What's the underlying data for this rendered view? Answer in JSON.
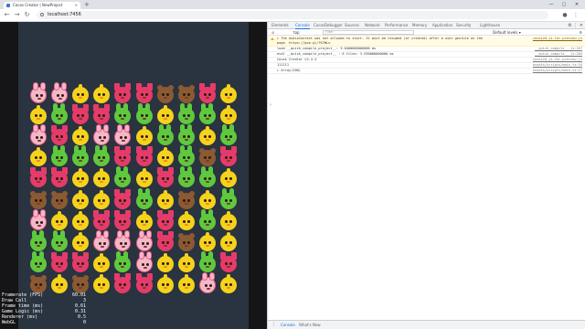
{
  "browser": {
    "tab_title": "Cocos Creator | NewProject",
    "tab_close": "×",
    "new_tab": "+",
    "address": "localhost:7456",
    "minimize": "—",
    "maximize": "▢",
    "close": "✕",
    "back": "←",
    "forward": "→",
    "reload": "↻",
    "profile": "●",
    "menu": "⋮"
  },
  "game": {
    "stats": [
      {
        "label": "Framerate (FPS)",
        "value": "60.01"
      },
      {
        "label": "Draw Call",
        "value": "3"
      },
      {
        "label": "Frame time (ms)",
        "value": "0.61"
      },
      {
        "label": "Game Logic (ms)",
        "value": "0.31"
      },
      {
        "label": "Renderer (ms)",
        "value": "0.5"
      },
      {
        "label": "WebGL",
        "value": "0"
      }
    ],
    "animal_colors": {
      "bunny": "#f5b7c8",
      "fox": "#e63b6a",
      "chick": "#f5d21c",
      "frog": "#5fc93e",
      "bear": "#8c5a32"
    },
    "grid": [
      [
        "bunny",
        "bunny",
        "chick",
        "chick",
        "fox",
        "fox",
        "bear",
        "bear",
        "fox",
        "chick"
      ],
      [
        "chick",
        "frog",
        "fox",
        "fox",
        "frog",
        "frog",
        "chick",
        "frog",
        "frog",
        "chick"
      ],
      [
        "bunny",
        "fox",
        "chick",
        "bunny",
        "bunny",
        "chick",
        "frog",
        "frog",
        "chick",
        "frog"
      ],
      [
        "chick",
        "frog",
        "frog",
        "frog",
        "fox",
        "fox",
        "chick",
        "frog",
        "bear",
        "fox"
      ],
      [
        "fox",
        "fox",
        "chick",
        "chick",
        "frog",
        "chick",
        "fox",
        "frog",
        "frog",
        "chick"
      ],
      [
        "bear",
        "bear",
        "chick",
        "chick",
        "fox",
        "frog",
        "chick",
        "bear",
        "chick",
        "frog"
      ],
      [
        "bunny",
        "chick",
        "chick",
        "fox",
        "fox",
        "chick",
        "fox",
        "chick",
        "frog",
        "chick"
      ],
      [
        "frog",
        "frog",
        "chick",
        "bunny",
        "bunny",
        "bunny",
        "fox",
        "bear",
        "chick",
        "chick"
      ],
      [
        "frog",
        "fox",
        "fox",
        "chick",
        "frog",
        "bunny",
        "chick",
        "chick",
        "frog",
        "fox"
      ],
      [
        "bear",
        "chick",
        "bear",
        "chick",
        "fox",
        "fox",
        "chick",
        "chick",
        "bunny",
        "chick"
      ]
    ]
  },
  "devtools": {
    "tabs": [
      "Elements",
      "Console",
      "CocosDebugger",
      "Sources",
      "Network",
      "Performance",
      "Memory",
      "Application",
      "Security",
      "Lighthouse"
    ],
    "active_tab": "Console",
    "context": "top",
    "filter_placeholder": "Filter",
    "levels": "Default levels ▾",
    "log": [
      {
        "type": "warn",
        "text": "▸ The AudioContext was not allowed to start. It must be resumed (or created) after a user gesture on the page. https://goo.gl/7K7WLu",
        "src": "cocos2d-js-for-preview.js"
      },
      {
        "type": "info",
        "text": "load __quick_compile_project__: 3.0400000000000 ms",
        "src": "__quick_compile__.js:167"
      },
      {
        "type": "info",
        "text": "eval __quick_compile_project__ : 6 files: 3.930000000000 ms",
        "src": "__quick_compile__.js:204"
      },
      {
        "type": "info",
        "text": "Cocos Creator v2.4.4",
        "src": "cocos2d-js-for-preview.js"
      },
      {
        "type": "info",
        "text": "111111",
        "src": "assets/scripts/main.ts:16"
      },
      {
        "type": "info",
        "text": "▸ Array(100)",
        "src": "assets/scripts/main.ts:17"
      }
    ],
    "prompt": "›",
    "drawer_tabs": [
      "Console",
      "What's New"
    ]
  }
}
